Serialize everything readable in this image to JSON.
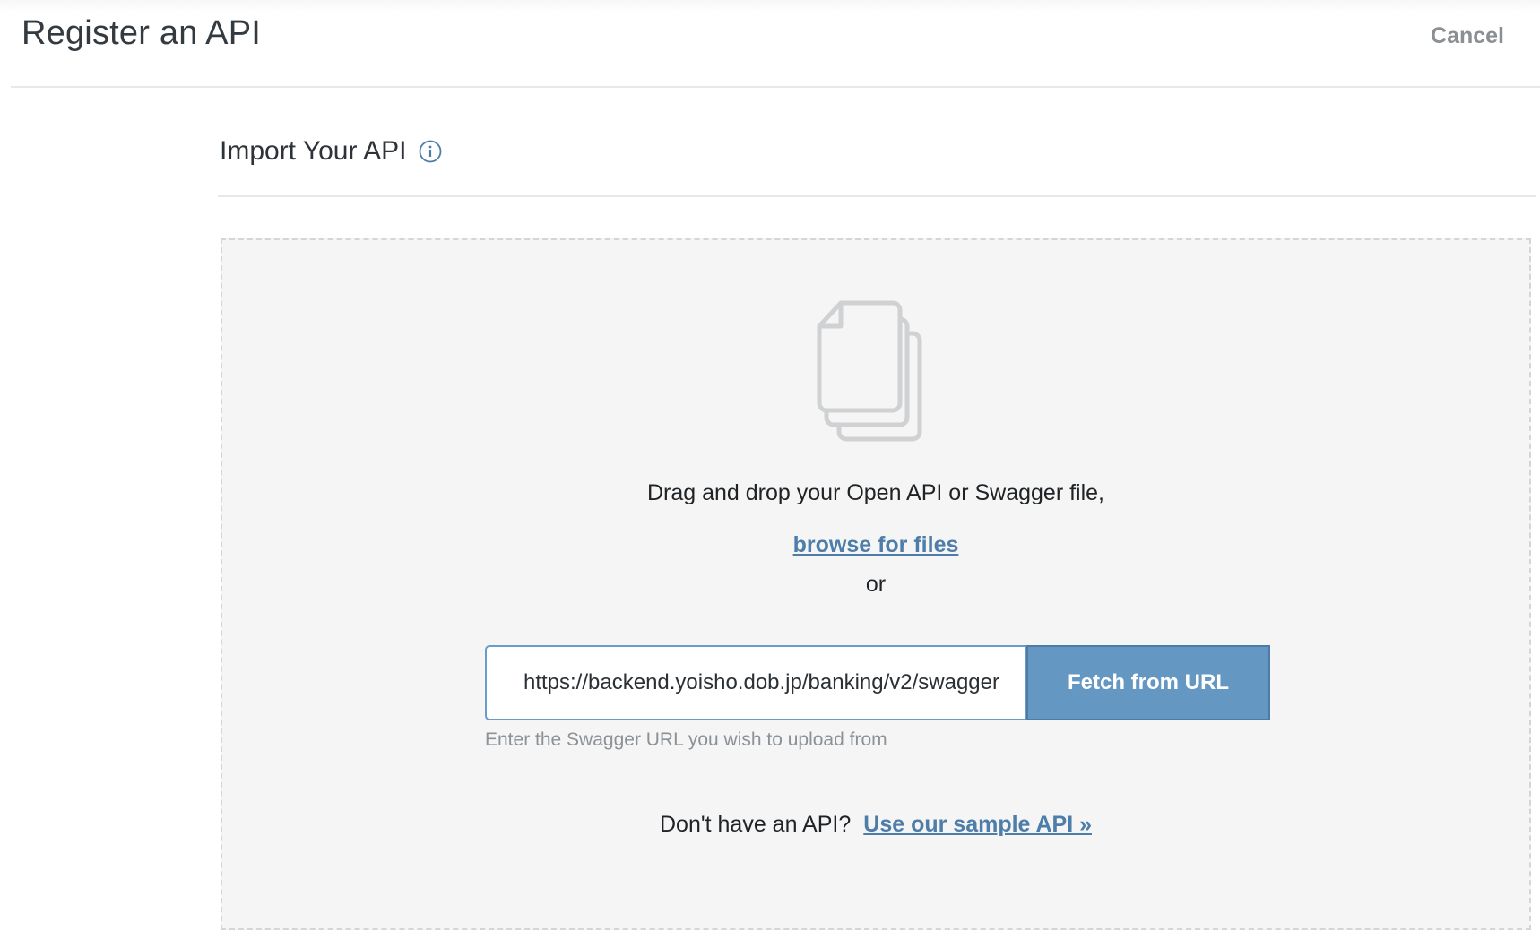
{
  "header": {
    "title": "Register an API",
    "cancel_label": "Cancel"
  },
  "section": {
    "title": "Import Your API",
    "info_icon": "info-circle-icon"
  },
  "dropzone": {
    "icon": "files-icon",
    "drag_text": "Drag and drop your Open API or Swagger file,",
    "browse_label": "browse for files",
    "or_text": "or",
    "url_input": {
      "value": "https://backend.yoisho.dob.jp/banking/v2/swagger",
      "hint": "Enter the Swagger URL you wish to upload from"
    },
    "fetch_label": "Fetch from URL",
    "no_api_text": "Don't have an API?",
    "sample_label": "Use our sample API »"
  },
  "colors": {
    "accent": "#6497c2",
    "link": "#4d7da8",
    "muted": "#8a8f94",
    "dropzone_bg": "#f5f5f5"
  }
}
